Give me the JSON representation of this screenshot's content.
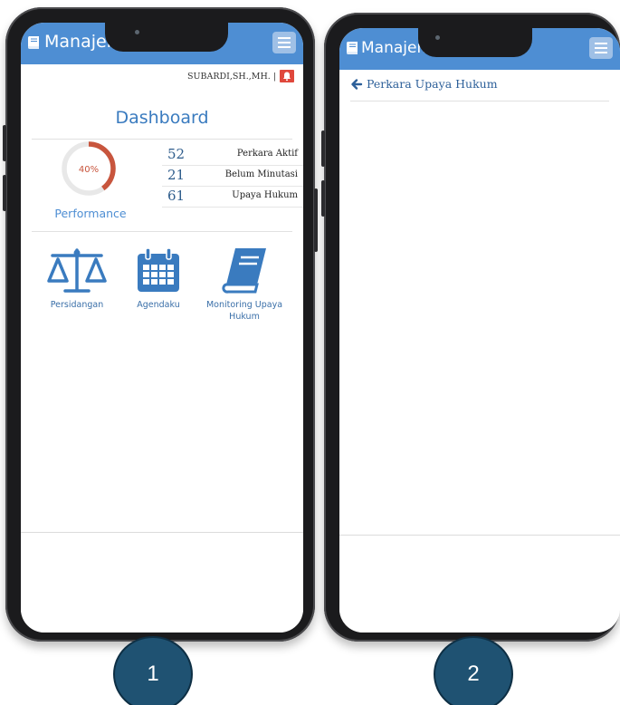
{
  "phone1": {
    "app_title": "Manajemen",
    "username": "SUBARDI,SH.,MH. |",
    "dashboard_title": "Dashboard",
    "performance": {
      "value": 0.4,
      "label_text": "40%",
      "caption": "Performance",
      "accent": "#c8553d",
      "track": "#e8e8e8"
    },
    "stats": [
      {
        "number": "52",
        "label": "Perkara Aktif"
      },
      {
        "number": "21",
        "label": "Belum Minutasi"
      },
      {
        "number": "61",
        "label": "Upaya Hukum"
      }
    ],
    "menu": [
      {
        "label": "Persidangan",
        "icon": "scales-icon"
      },
      {
        "label": "Agendaku",
        "icon": "calendar-icon"
      },
      {
        "label": "Monitoring Upaya Hukum",
        "icon": "book-icon"
      }
    ]
  },
  "phone2": {
    "app_title": "Manajem",
    "back_label": "Perkara Upaya Hukum"
  },
  "badges": [
    "1",
    "2"
  ],
  "colors": {
    "appbar": "#4e8ed3",
    "badge": "#1f5272",
    "link": "#2c5f99",
    "bell": "#e0483c"
  }
}
